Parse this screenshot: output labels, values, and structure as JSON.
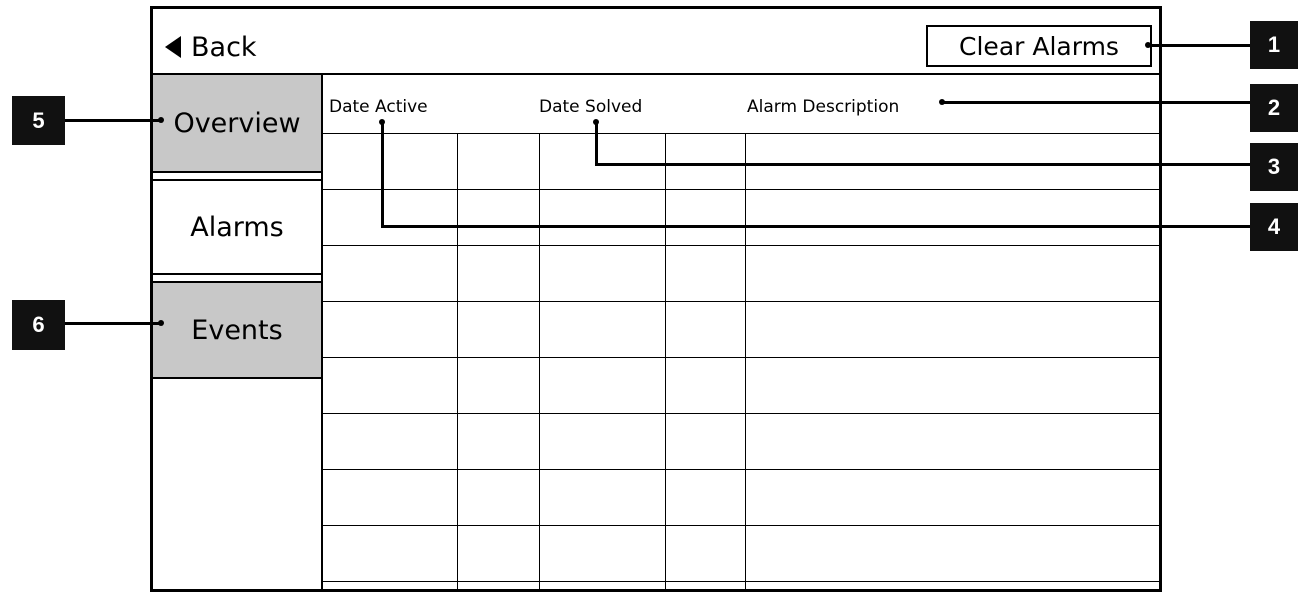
{
  "header": {
    "back_label": "Back",
    "clear_label": "Clear Alarms"
  },
  "sidebar": {
    "items": [
      {
        "label": "Overview",
        "selected": false
      },
      {
        "label": "Alarms",
        "selected": true
      },
      {
        "label": "Events",
        "selected": false
      }
    ]
  },
  "table": {
    "columns": [
      "Date Active",
      "Date Solved",
      "Alarm Description"
    ],
    "row_count": 8
  },
  "callouts": [
    "1",
    "2",
    "3",
    "4",
    "5",
    "6"
  ],
  "colors": {
    "tab_inactive": "#c8c8c8",
    "tab_active": "#ffffff",
    "callout_bg": "#111111",
    "callout_text": "#ffffff"
  }
}
